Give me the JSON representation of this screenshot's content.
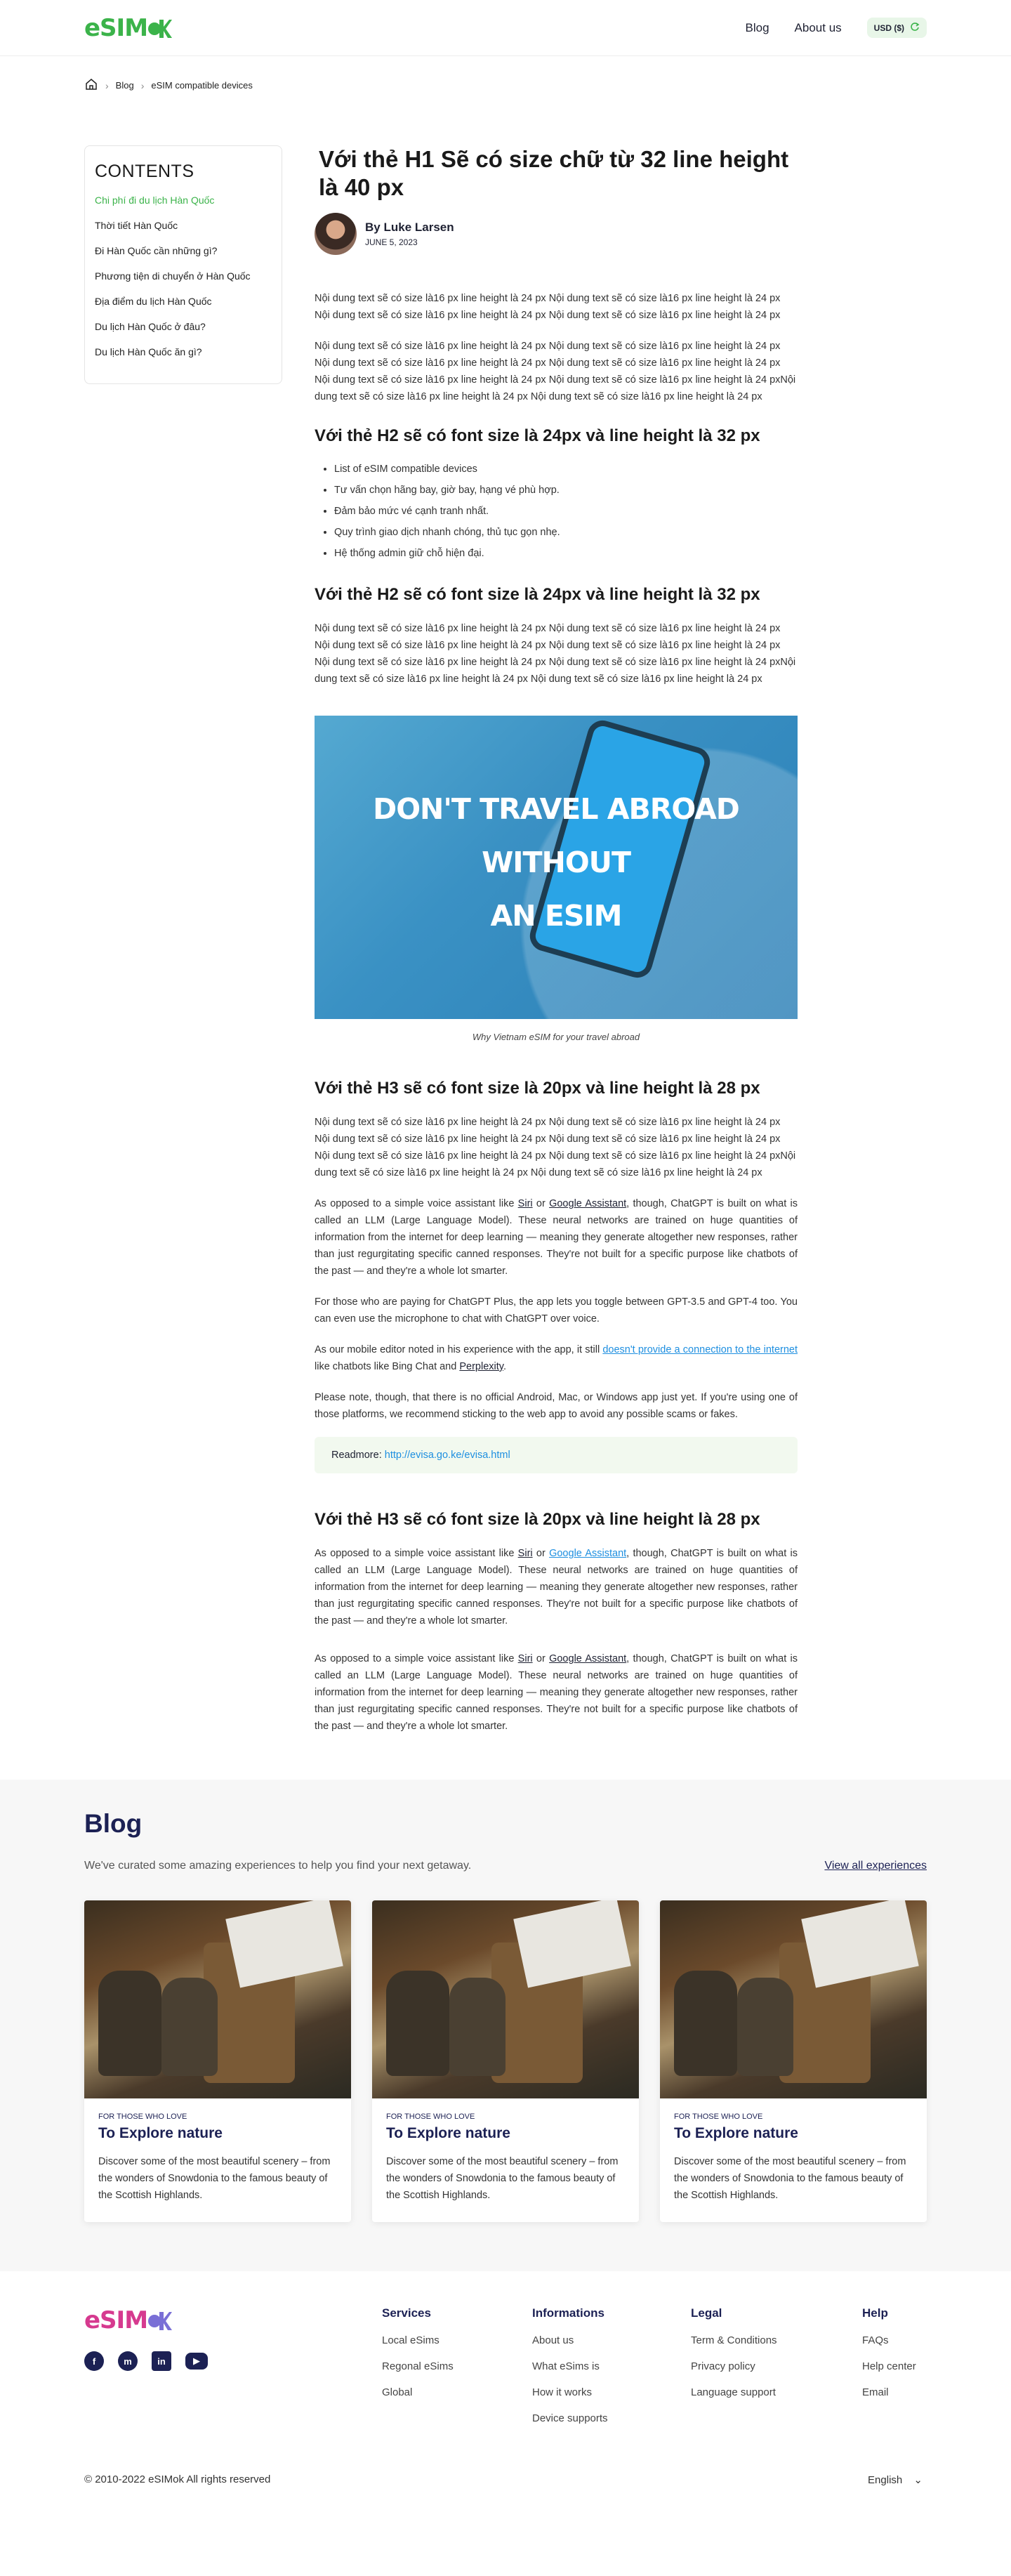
{
  "header": {
    "logo": "eSIM",
    "nav": [
      "Blog",
      "About us"
    ],
    "currency": "USD ($)"
  },
  "breadcrumb": [
    "Blog",
    "eSIM compatible devices"
  ],
  "toc": {
    "title": "CONTENTS",
    "items": [
      "Chi phí đi du lịch Hàn Quốc",
      "Thời tiết Hàn Quốc",
      "Đi Hàn Quốc cần những gì?",
      "Phương tiện di chuyển ở Hàn Quốc",
      "Địa điểm du lịch Hàn Quốc",
      "Du lịch Hàn Quốc ở đâu?",
      "Du lịch Hàn Quốc ăn gì?"
    ]
  },
  "article": {
    "title": "Với thẻ H1 Sẽ có size chữ từ 32 line height là 40 px",
    "author_prefix": "By",
    "author": "Luke Larsen",
    "date": "JUNE 5, 2023",
    "p1": "Nội dung text sẽ có size là16 px line height là 24 px Nội dung text sẽ có size là16 px line height là 24 px Nội dung text sẽ có size là16 px line height là 24 px Nội dung text sẽ có size là16 px line height là 24 px",
    "p2": "Nội dung text sẽ có size là16 px line height là 24 px Nội dung text sẽ có size là16 px line height là 24 px Nội dung text sẽ có size là16 px line height là 24 px Nội dung text sẽ có size là16 px line height là 24 px Nội dung text sẽ có size là16 px line height là 24 px Nội dung text sẽ có size là16 px line height là 24 pxNội dung text sẽ có size là16 px line height là 24 px Nội dung text sẽ có size là16 px line height là 24 px",
    "h2a": "Với thẻ H2 sẽ có font size là 24px và line height là 32 px",
    "bullets": [
      "List of eSIM compatible devices",
      "Tư vấn chọn hãng bay, giờ bay, hạng vé phù hợp.",
      "Đảm bảo mức vé cạnh tranh nhất.",
      "Quy trình giao dịch nhanh chóng, thủ tục gọn nhẹ.",
      "Hệ thống admin giữ chỗ hiện đại."
    ],
    "h2b": "Với thẻ H2 sẽ có font size là 24px và line height là 32 px",
    "p3": "Nội dung text sẽ có size là16 px line height là 24 px Nội dung text sẽ có size là16 px line height là 24 px Nội dung text sẽ có size là16 px line height là 24 px Nội dung text sẽ có size là16 px line height là 24 px Nội dung text sẽ có size là16 px line height là 24 px Nội dung text sẽ có size là16 px line height là 24 pxNội dung text sẽ có size là16 px line height là 24 px Nội dung text sẽ có size là16 px line height là 24 px",
    "hero_lines": [
      "DON'T TRAVEL ABROAD",
      "WITHOUT",
      "AN ESIM"
    ],
    "caption": "Why Vietnam eSIM for your travel abroad",
    "h3a": "Với thẻ H3 sẽ có font size là 20px và line height là 28 px",
    "p4": "Nội dung text sẽ có size là16 px line height là 24 px Nội dung text sẽ có size là16 px line height là 24 px Nội dung text sẽ có size là16 px line height là 24 px Nội dung text sẽ có size là16 px line height là 24 px Nội dung text sẽ có size là16 px line height là 24 px Nội dung text sẽ có size là16 px line height là 24 pxNội dung text sẽ có size là16 px line height là 24 px Nội dung text sẽ có size là16 px line height là 24 px",
    "p5_a": "As opposed to a simple voice assistant like",
    "siri": "Siri",
    "or": "or",
    "google": "Google Assistant",
    "p5_b": ", though, ChatGPT is built on what is called an LLM (Large Language Model). These neural networks are trained on huge quantities of information from the internet for deep learning — meaning they generate altogether new responses, rather than just regurgitating specific canned responses. They're not built for a specific purpose like chatbots of the past — and they're a whole lot smarter.",
    "p6": "For those who are paying for ChatGPT Plus, the app lets you toggle between GPT-3.5 and GPT-4 too. You can even use the microphone to chat with ChatGPT over voice.",
    "p7_a": "As our mobile editor noted in his experience with the app, it still",
    "p7_link": "doesn't provide a connection to the internet",
    "p7_b": "like chatbots like Bing Chat and",
    "perplexity": "Perplexity",
    "p7_end": ".",
    "p8": "Please note, though, that there is no official Android, Mac, or Windows app just yet. If you're using one of those platforms, we recommend sticking to the web app to avoid any possible scams or fakes.",
    "readmore_label": "Readmore:",
    "readmore_url": "http://evisa.go.ke/evisa.html",
    "h3b": "Với thẻ H3 sẽ có font size là 20px và line height là 28 px"
  },
  "blog": {
    "title": "Blog",
    "subtitle": "We've curated some amazing experiences to help you find your next getaway.",
    "view_all": "View all experiences",
    "cards": [
      {
        "kicker": "FOR THOSE WHO LOVE",
        "title": "To Explore nature",
        "desc": "Discover some of the most beautiful scenery – from the wonders of Snowdonia to the famous beauty of the Scottish Highlands."
      },
      {
        "kicker": "FOR THOSE WHO LOVE",
        "title": "To Explore nature",
        "desc": "Discover some of the most beautiful scenery – from the wonders of Snowdonia to the famous beauty of the Scottish Highlands."
      },
      {
        "kicker": "FOR THOSE WHO LOVE",
        "title": "To Explore nature",
        "desc": "Discover some of the most beautiful scenery – from the wonders of Snowdonia to the famous beauty of the Scottish Highlands."
      }
    ]
  },
  "footer": {
    "logo": "eSIM",
    "columns": [
      {
        "title": "Services",
        "items": [
          "Local eSims",
          "Regonal eSims",
          "Global"
        ]
      },
      {
        "title": "Informations",
        "items": [
          "About us",
          "What eSims is",
          "How it works",
          "Device supports"
        ]
      },
      {
        "title": "Legal",
        "items": [
          "Term & Conditions",
          "Privacy policy",
          "Language support"
        ]
      },
      {
        "title": "Help",
        "items": [
          "FAQs",
          "Help center",
          "Email"
        ]
      }
    ],
    "copyright": "© 2010-2022 eSIMok All rights reserved",
    "language": "English"
  },
  "colors": {
    "brand_green": "#3bb34a",
    "brand_purple": "#7a6fd6",
    "navy": "#1c2154",
    "link_blue": "#1e8fe0"
  }
}
